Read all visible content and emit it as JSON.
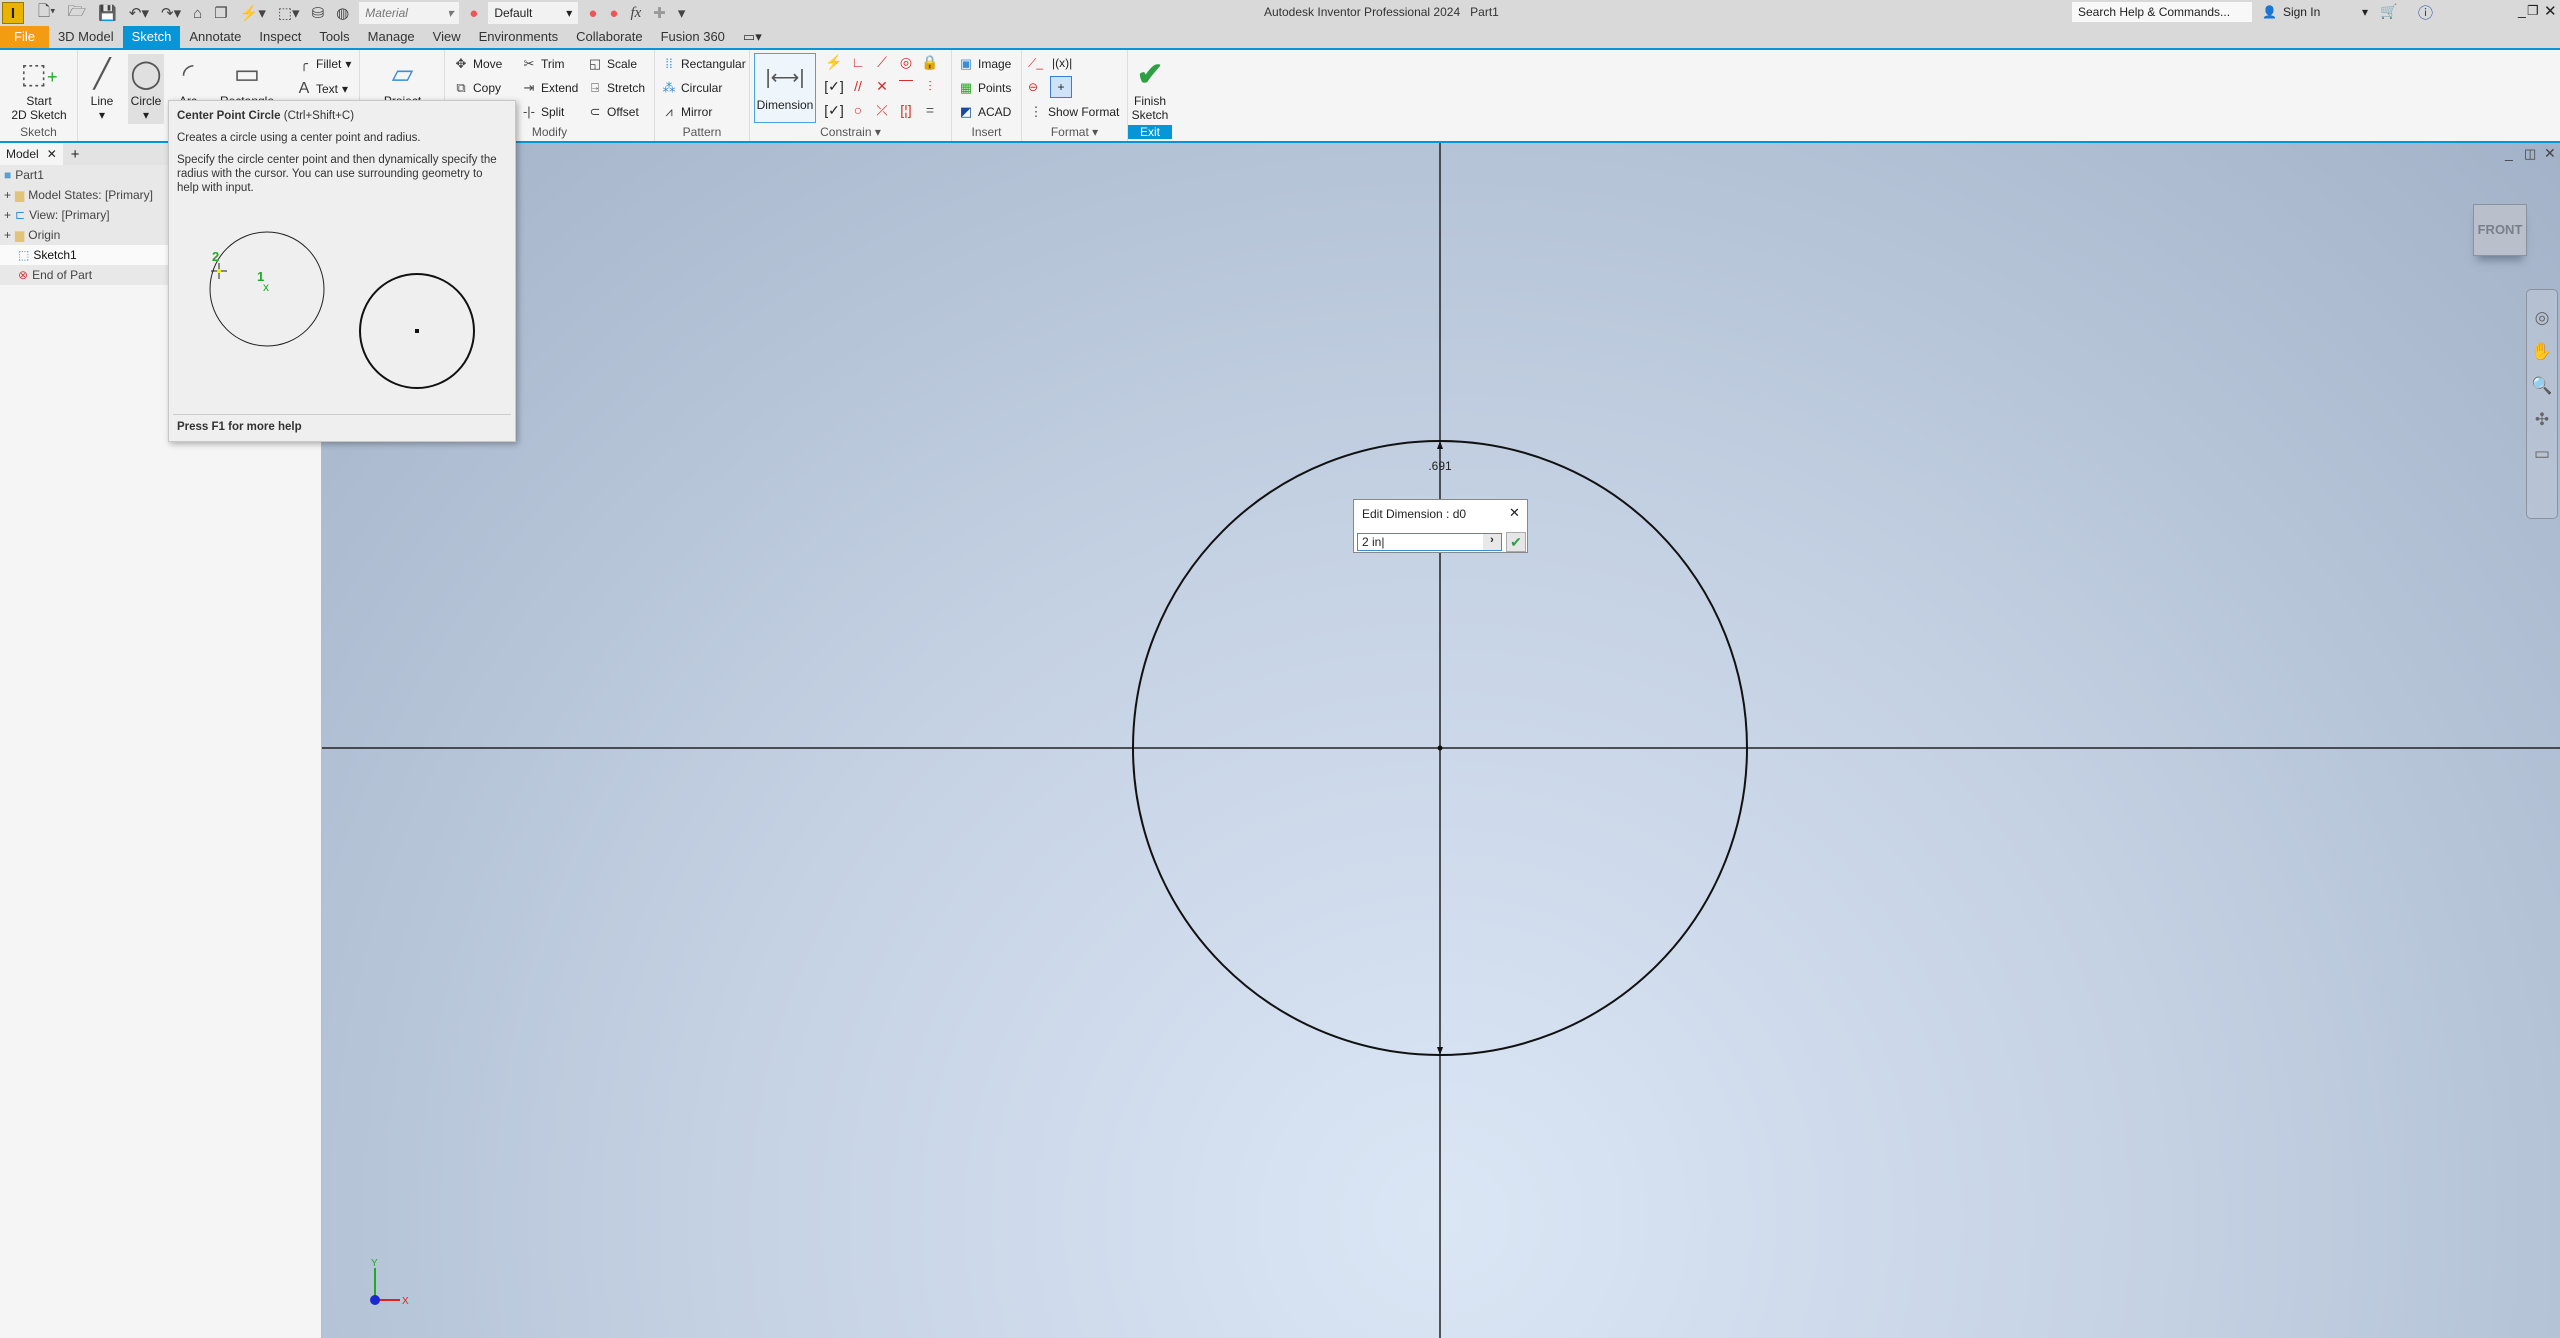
{
  "app": {
    "title": "Autodesk Inventor Professional 2024",
    "document": "Part1",
    "logo_letter": "I"
  },
  "qat": {
    "material": "Material",
    "appearance": "Default",
    "fx": "fx"
  },
  "search": {
    "placeholder": "Search Help & Commands..."
  },
  "account": {
    "sign_in": "Sign In"
  },
  "tabs": [
    "File",
    "3D Model",
    "Sketch",
    "Annotate",
    "Inspect",
    "Tools",
    "Manage",
    "View",
    "Environments",
    "Collaborate",
    "Fusion 360"
  ],
  "active_tab": "Sketch",
  "ribbon": {
    "sketch": {
      "label": "Sketch",
      "start": "Start\n2D Sketch"
    },
    "create": {
      "line": "Line",
      "circle": "Circle",
      "arc": "Arc",
      "rectangle": "Rectangle",
      "fillet": "Fillet",
      "text": "Text"
    },
    "project": {
      "label": "Project"
    },
    "modify": {
      "label": "Modify",
      "move": "Move",
      "copy": "Copy",
      "trim": "Trim",
      "extend": "Extend",
      "split": "Split",
      "scale": "Scale",
      "stretch": "Stretch",
      "offset": "Offset"
    },
    "pattern": {
      "label": "Pattern",
      "rectangular": "Rectangular",
      "circular": "Circular",
      "mirror": "Mirror"
    },
    "constrain": {
      "label": "Constrain",
      "dimension": "Dimension"
    },
    "insert": {
      "label": "Insert",
      "image": "Image",
      "points": "Points",
      "acad": "ACAD"
    },
    "format": {
      "label": "Format",
      "show_format": "Show Format"
    },
    "exit": {
      "label": "Exit",
      "finish": "Finish\nSketch"
    }
  },
  "browser": {
    "tab": "Model",
    "nodes": [
      "Part1",
      "Model States: [Primary]",
      "View: [Primary]",
      "Origin",
      "Sketch1",
      "End of Part"
    ]
  },
  "tooltip": {
    "title": "Center Point Circle",
    "shortcut": "(Ctrl+Shift+C)",
    "summary": "Creates a circle using a center point and radius.",
    "detail": "Specify the circle center point and then dynamically specify the radius with the cursor. You can use surrounding geometry to help with input.",
    "step1": "1",
    "step2": "2",
    "footer": "Press F1 for more help"
  },
  "viewport": {
    "dimension_value": ".691",
    "viewcube_face": "FRONT",
    "axis_x": "X",
    "axis_y": "Y"
  },
  "dialog": {
    "title": "Edit Dimension : d0",
    "value": "2 in"
  },
  "colors": {
    "accent": "#0696d7",
    "file_tab": "#f39c12",
    "finish_check": "#2ea043"
  }
}
